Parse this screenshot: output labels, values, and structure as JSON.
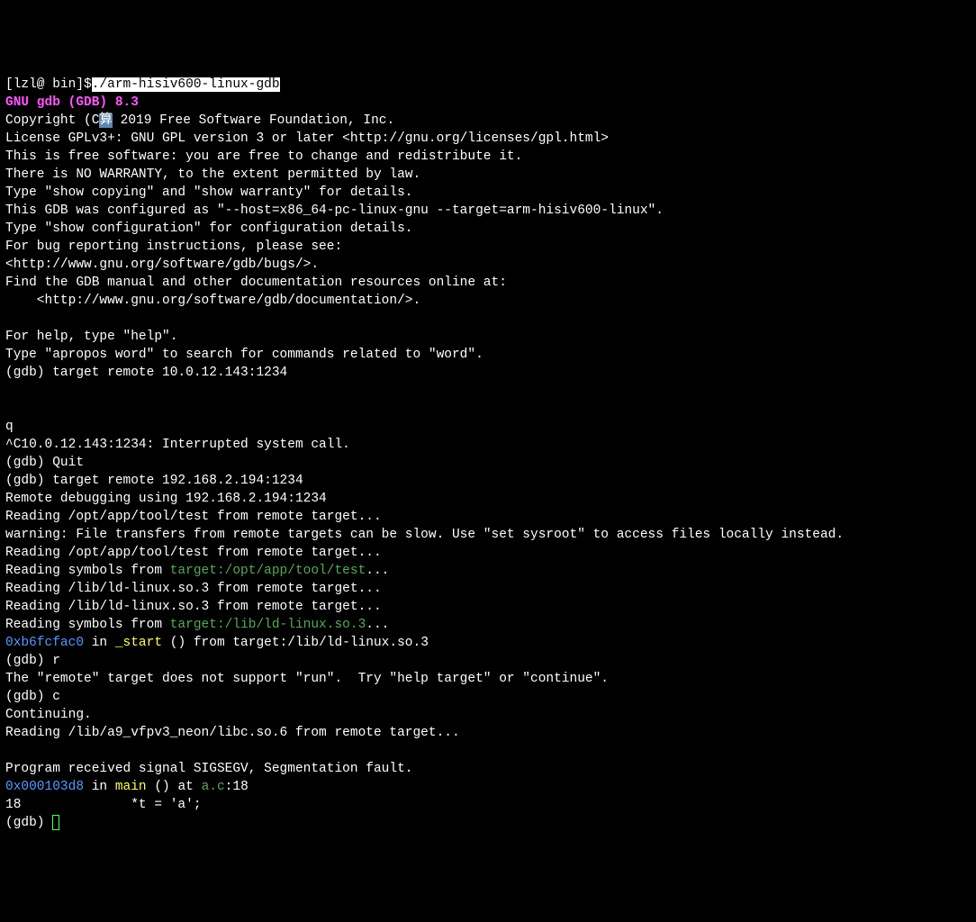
{
  "prompt": {
    "prefix": "[lzl@ bin]$",
    "cmd": "./arm-hisiv600-linux-gdb"
  },
  "banner": {
    "title": "GNU gdb (GDB) 8.3",
    "copyright_pre": "Copyright (C",
    "copyright_icon": "算",
    "copyright_post": " 2019 Free Software Foundation, Inc.",
    "license": "License GPLv3+: GNU GPL version 3 or later <http://gnu.org/licenses/gpl.html>",
    "free1": "This is free software: you are free to change and redistribute it.",
    "free2": "There is NO WARRANTY, to the extent permitted by law.",
    "showcopy": "Type \"show copying\" and \"show warranty\" for details.",
    "configured": "This GDB was configured as \"--host=x86_64-pc-linux-gnu --target=arm-hisiv600-linux\".",
    "showconf": "Type \"show configuration\" for configuration details.",
    "bugs1": "For bug reporting instructions, please see:",
    "bugs2": "<http://www.gnu.org/software/gdb/bugs/>.",
    "manual1": "Find the GDB manual and other documentation resources online at:",
    "manual2": "    <http://www.gnu.org/software/gdb/documentation/>.",
    "help1": "For help, type \"help\".",
    "help2": "Type \"apropos word\" to search for commands related to \"word\"."
  },
  "session": {
    "g1": "(gdb) target remote 10.0.12.143:1234",
    "q": "q",
    "interrupt": "^C10.0.12.143:1234: Interrupted system call.",
    "quit": "(gdb) Quit",
    "g2": "(gdb) target remote 192.168.2.194:1234",
    "remote_using": "Remote debugging using 192.168.2.194:1234",
    "read1": "Reading /opt/app/tool/test from remote target...",
    "warn": "warning: File transfers from remote targets can be slow. Use \"set sysroot\" to access files locally instead.",
    "read2": "Reading /opt/app/tool/test from remote target...",
    "readsym1_pre": "Reading symbols from ",
    "readsym1_path": "target:/opt/app/tool/test",
    "read3": "Reading /lib/ld-linux.so.3 from remote target...",
    "read4": "Reading /lib/ld-linux.so.3 from remote target...",
    "readsym2_pre": "Reading symbols from ",
    "readsym2_path": "target:/lib/ld-linux.so.3",
    "dots": "...",
    "addr1": "0xb6fcfac0",
    "in1": " in ",
    "start": "_start",
    "tail1": " () from target:/lib/ld-linux.so.3",
    "gdb_r": "(gdb) r",
    "noremote": "The \"remote\" target does not support \"run\".  Try \"help target\" or \"continue\".",
    "gdb_c": "(gdb) c",
    "cont": "Continuing.",
    "read5": "Reading /lib/a9_vfpv3_neon/libc.so.6 from remote target...",
    "sig": "Program received signal SIGSEGV, Segmentation fault.",
    "addr2": "0x000103d8",
    "in2": " in ",
    "mainfn": "main",
    "at": " () at ",
    "srcfile": "a.c",
    "lineno": ":18",
    "srcline": "18              *t = 'a';",
    "gdb_prompt": "(gdb) "
  }
}
